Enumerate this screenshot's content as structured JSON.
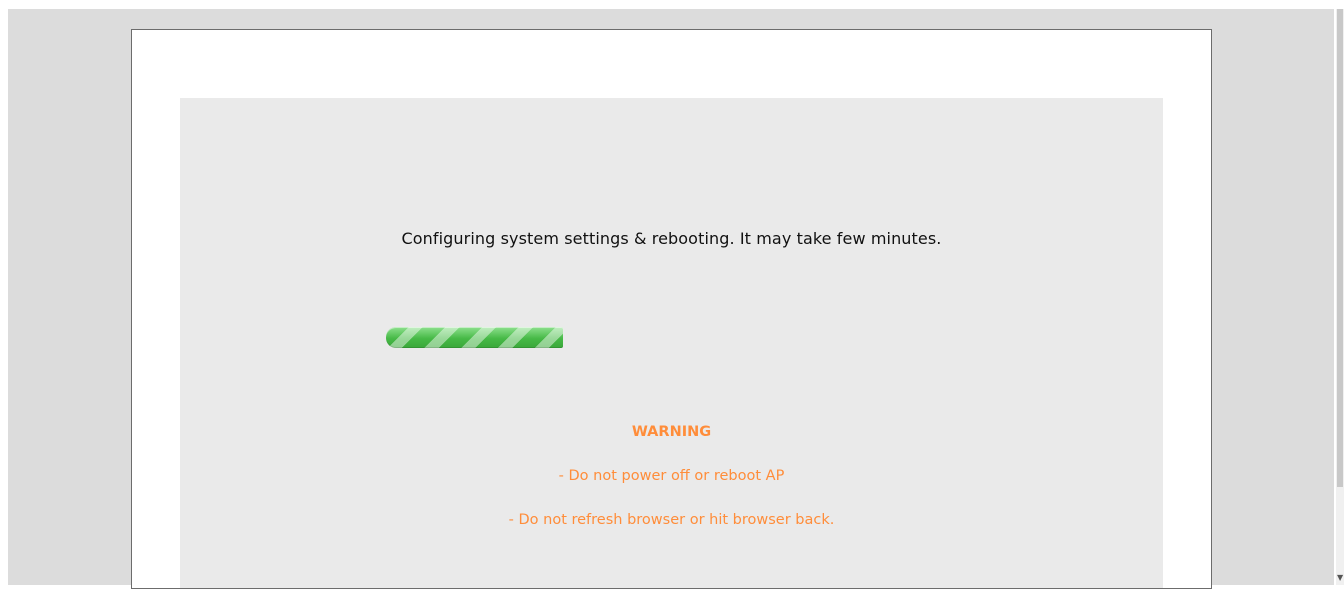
{
  "status": {
    "message": "Configuring system settings & rebooting. It may take few minutes."
  },
  "progress": {
    "value": 0.34,
    "color": "#5cc85c"
  },
  "warning": {
    "title": "WARNING",
    "line1": "- Do not power off or reboot AP",
    "line2": "- Do not refresh browser or hit browser back.",
    "color": "#ff8d3a"
  },
  "icons": {
    "scroll_down": "chevron-down-icon"
  }
}
